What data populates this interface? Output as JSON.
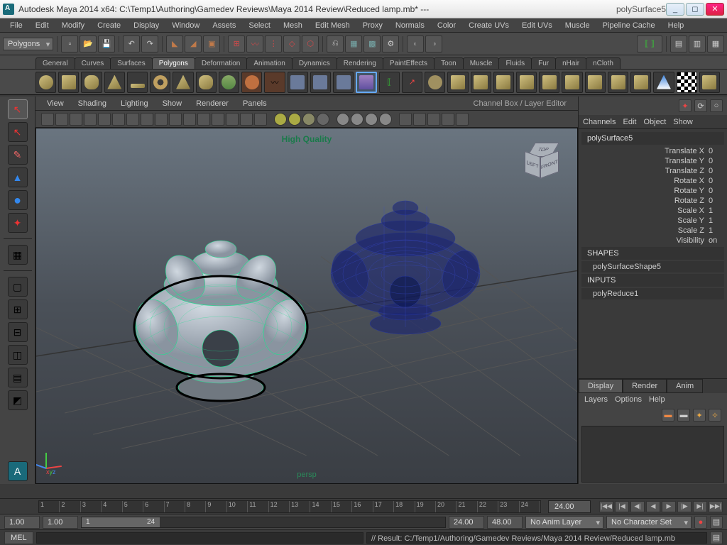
{
  "title": {
    "app": "Autodesk Maya 2014 x64: C:\\Temp1\\Authoring\\Gamedev Reviews\\Maya 2014 Review\\Reduced lamp.mb*   ---",
    "object": "polySurface5"
  },
  "menu": [
    "File",
    "Edit",
    "Modify",
    "Create",
    "Display",
    "Window",
    "Assets",
    "Select",
    "Mesh",
    "Edit Mesh",
    "Proxy",
    "Normals",
    "Color",
    "Create UVs",
    "Edit UVs",
    "Muscle",
    "Pipeline Cache",
    "Help"
  ],
  "module_dropdown": "Polygons",
  "shelf_tabs": [
    "General",
    "Curves",
    "Surfaces",
    "Polygons",
    "Deformation",
    "Animation",
    "Dynamics",
    "Rendering",
    "PaintEffects",
    "Toon",
    "Muscle",
    "Fluids",
    "Fur",
    "nHair",
    "nCloth"
  ],
  "shelf_active": 3,
  "panel_menu": [
    "View",
    "Shading",
    "Lighting",
    "Show",
    "Renderer",
    "Panels"
  ],
  "panel_right_title": "Channel Box / Layer Editor",
  "viewport": {
    "quality": "High Quality",
    "camera": "persp",
    "cube_faces": [
      "TOP",
      "LEFT",
      "FRONT"
    ]
  },
  "channels": {
    "menu": [
      "Channels",
      "Edit",
      "Object",
      "Show"
    ],
    "name": "polySurface5",
    "rows": [
      {
        "lbl": "Translate X",
        "val": "0"
      },
      {
        "lbl": "Translate Y",
        "val": "0"
      },
      {
        "lbl": "Translate Z",
        "val": "0"
      },
      {
        "lbl": "Rotate X",
        "val": "0"
      },
      {
        "lbl": "Rotate Y",
        "val": "0"
      },
      {
        "lbl": "Rotate Z",
        "val": "0"
      },
      {
        "lbl": "Scale X",
        "val": "1"
      },
      {
        "lbl": "Scale Y",
        "val": "1"
      },
      {
        "lbl": "Scale Z",
        "val": "1"
      },
      {
        "lbl": "Visibility",
        "val": "on"
      }
    ],
    "shapes_hdr": "SHAPES",
    "shape_name": "polySurfaceShape5",
    "inputs_hdr": "INPUTS",
    "input_name": "polyReduce1"
  },
  "layers": {
    "tabs": [
      "Display",
      "Render",
      "Anim"
    ],
    "menu": [
      "Layers",
      "Options",
      "Help"
    ]
  },
  "timeline": {
    "ticks": [
      "1",
      "2",
      "3",
      "4",
      "5",
      "6",
      "7",
      "8",
      "9",
      "10",
      "11",
      "12",
      "13",
      "14",
      "15",
      "16",
      "17",
      "18",
      "19",
      "20",
      "21",
      "22",
      "23",
      "24"
    ],
    "current": "24.00"
  },
  "range": {
    "start_outer": "1.00",
    "start": "1.00",
    "sl_start": "1",
    "sl_end": "24",
    "end": "24.00",
    "end_outer": "48.00",
    "animlayer": "No Anim Layer",
    "charset": "No Character Set"
  },
  "cmd": {
    "lang": "MEL",
    "result": "// Result: C:/Temp1/Authoring/Gamedev Reviews/Maya 2014 Review/Reduced lamp.mb"
  }
}
